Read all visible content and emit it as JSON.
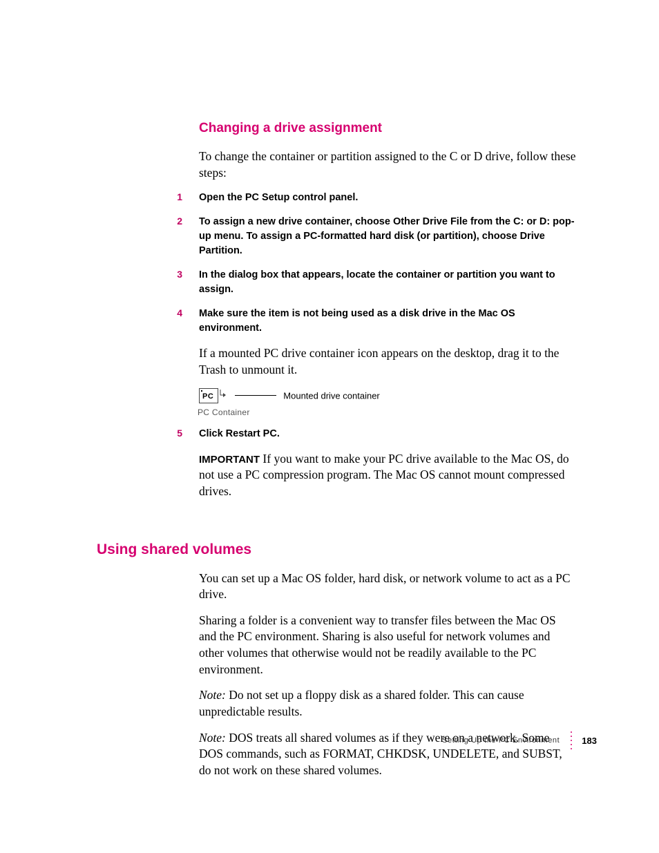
{
  "heading1": "Changing a drive assignment",
  "para1": "To change the container or partition assigned to the C or D drive, follow these steps:",
  "steps": {
    "n1": "1",
    "t1": "Open the PC Setup control panel.",
    "n2": "2",
    "t2": "To assign a new drive container, choose Other Drive File from the C: or D: pop-up menu. To assign a PC-formatted hard disk (or partition), choose Drive Partition.",
    "n3": "3",
    "t3": "In the dialog box that appears, locate the container or partition you want to assign.",
    "n4": "4",
    "t4": "Make sure the item is not being used as a disk drive in the Mac OS environment.",
    "sub4": "If a mounted PC drive container icon appears on the desktop, drag it to the Trash to unmount it.",
    "n5": "5",
    "t5": "Click Restart PC."
  },
  "figure": {
    "iconText": "PC",
    "callout": "Mounted drive container",
    "below": "PC Container"
  },
  "importantLabel": "IMPORTANT",
  "importantBody": "  If you want to make your PC drive available to the Mac OS, do not use a PC compression program. The Mac OS cannot mount compressed drives.",
  "heading2": "Using shared volumes",
  "para2a": "You can set up a Mac OS folder, hard disk, or network volume to act as a PC drive.",
  "para2b": "Sharing a folder is a convenient way to transfer files between the Mac OS and the PC environment. Sharing is also useful for network volumes and other volumes that otherwise would not be readily available to the PC environment.",
  "noteLabel": "Note:",
  "note1": "  Do not set up a floppy disk as a shared folder. This can cause unpredictable results.",
  "note2": "  DOS treats all shared volumes as if they were on a network. Some DOS commands, such as FORMAT, CHKDSK, UNDELETE, and SUBST, do not work on these shared volumes.",
  "footer": {
    "title": "Setting Up the PC Environment",
    "page": "183"
  }
}
